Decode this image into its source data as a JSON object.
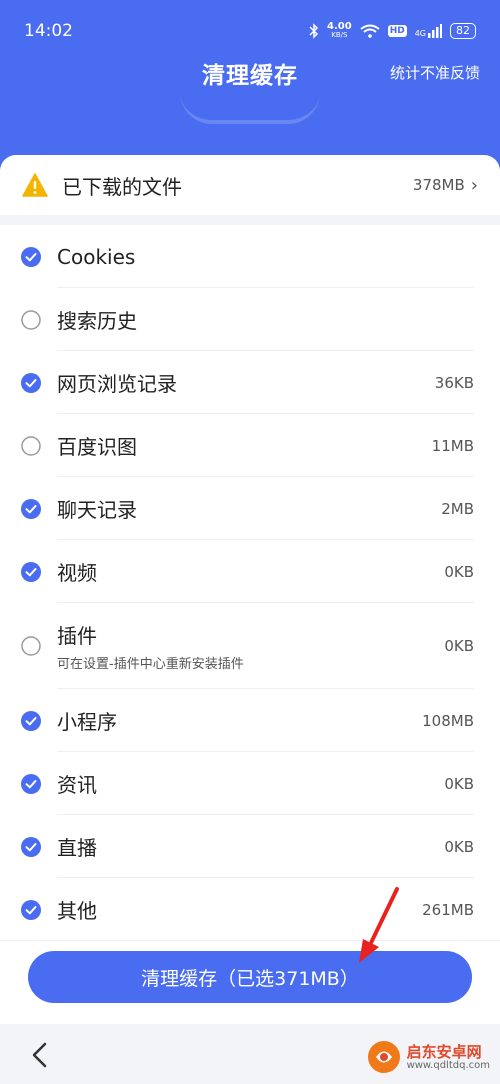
{
  "status_bar": {
    "time": "14:02",
    "net_speed": "4.00",
    "net_unit": "KB/S",
    "hd": "HD",
    "signal": "4G",
    "battery": "82"
  },
  "header": {
    "title": "清理缓存",
    "feedback": "统计不准反馈"
  },
  "downloads": {
    "label": "已下载的文件",
    "size": "378MB"
  },
  "items": [
    {
      "label": "Cookies",
      "size": "",
      "checked": true,
      "sub": ""
    },
    {
      "label": "搜索历史",
      "size": "",
      "checked": false,
      "sub": ""
    },
    {
      "label": "网页浏览记录",
      "size": "36KB",
      "checked": true,
      "sub": ""
    },
    {
      "label": "百度识图",
      "size": "11MB",
      "checked": false,
      "sub": ""
    },
    {
      "label": "聊天记录",
      "size": "2MB",
      "checked": true,
      "sub": ""
    },
    {
      "label": "视频",
      "size": "0KB",
      "checked": true,
      "sub": ""
    },
    {
      "label": "插件",
      "size": "0KB",
      "checked": false,
      "sub": "可在设置-插件中心重新安装插件"
    },
    {
      "label": "小程序",
      "size": "108MB",
      "checked": true,
      "sub": ""
    },
    {
      "label": "资讯",
      "size": "0KB",
      "checked": true,
      "sub": ""
    },
    {
      "label": "直播",
      "size": "0KB",
      "checked": true,
      "sub": ""
    },
    {
      "label": "其他",
      "size": "261MB",
      "checked": true,
      "sub": ""
    }
  ],
  "clean_button": "清理缓存（已选371MB）",
  "watermark": {
    "name": "启东安卓网",
    "url": "www.qdltdq.com"
  },
  "colors": {
    "primary": "#4a6cf0",
    "warning": "#f5b400",
    "arrow": "#e8231f"
  }
}
